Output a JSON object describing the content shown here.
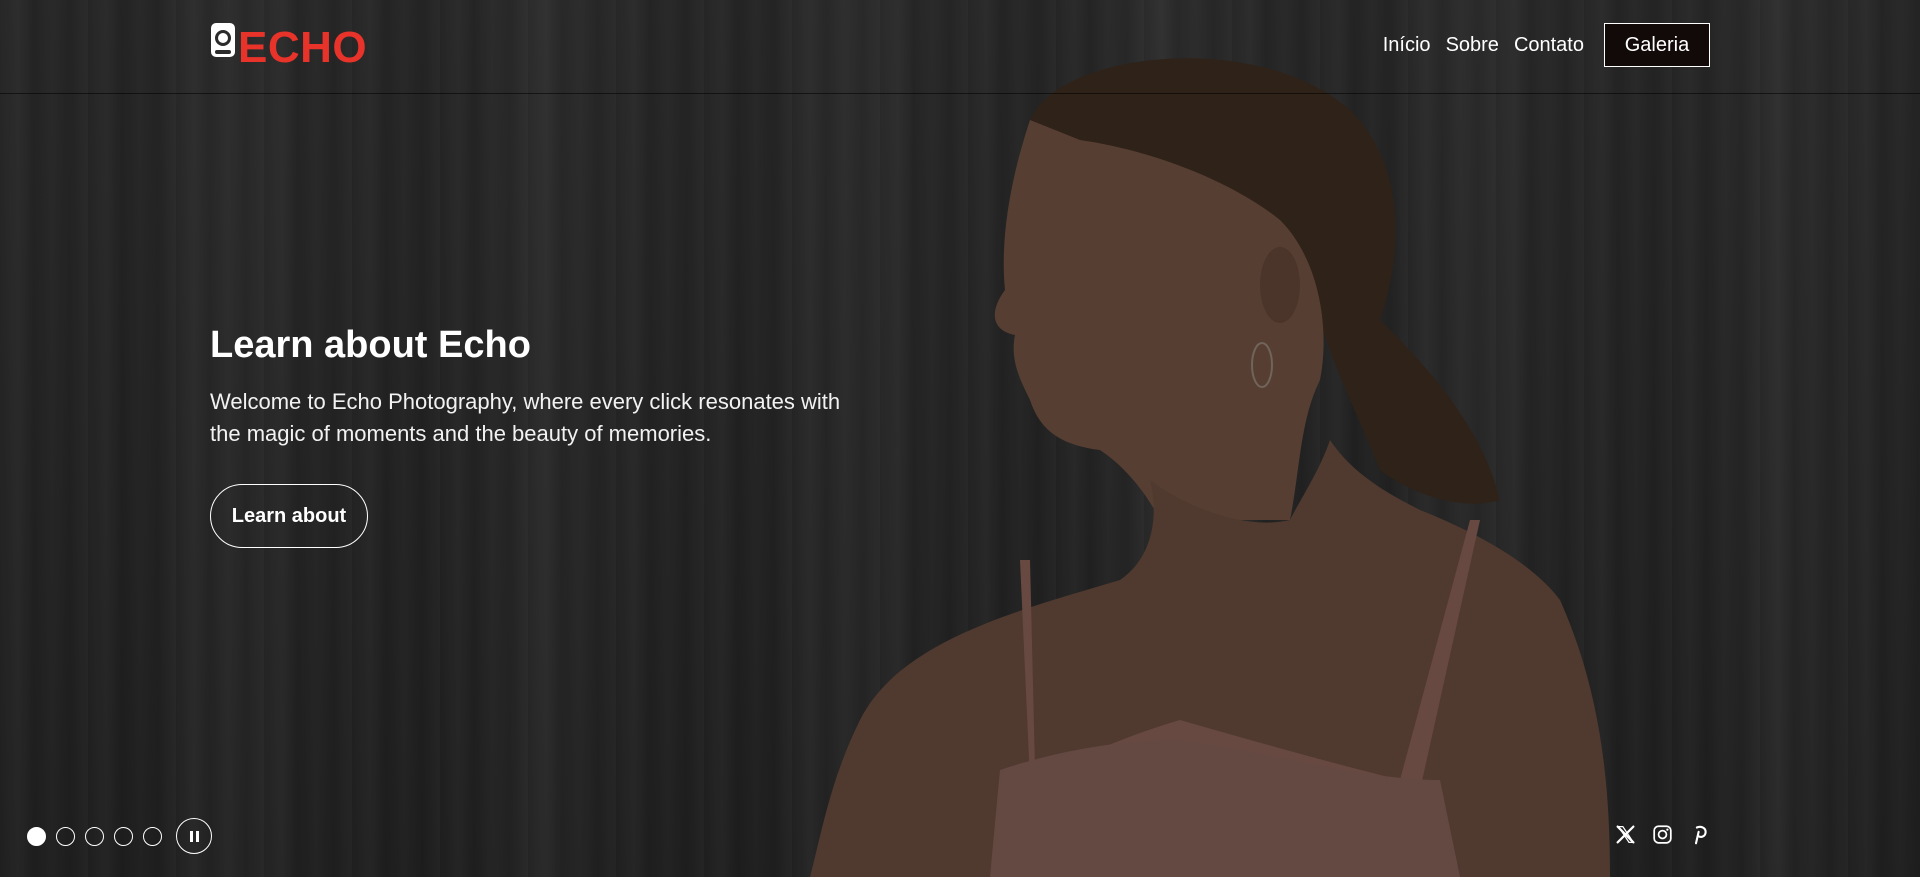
{
  "brand": {
    "name": "ECHO",
    "icon": "camera-lens-icon",
    "accent_color": "#e8332a"
  },
  "nav": {
    "links": [
      "Início",
      "Sobre",
      "Contato"
    ],
    "cta_label": "Galeria"
  },
  "hero": {
    "title": "Learn about Echo",
    "text": "Welcome to Echo Photography, where every click resonates with the magic of moments and the beauty of memories.",
    "button_label": "Learn about"
  },
  "slider": {
    "slide_count": 5,
    "active_slide": 1,
    "pause_icon": "pause-icon"
  },
  "socials": [
    "x-icon",
    "instagram-icon",
    "pinterest-icon"
  ]
}
